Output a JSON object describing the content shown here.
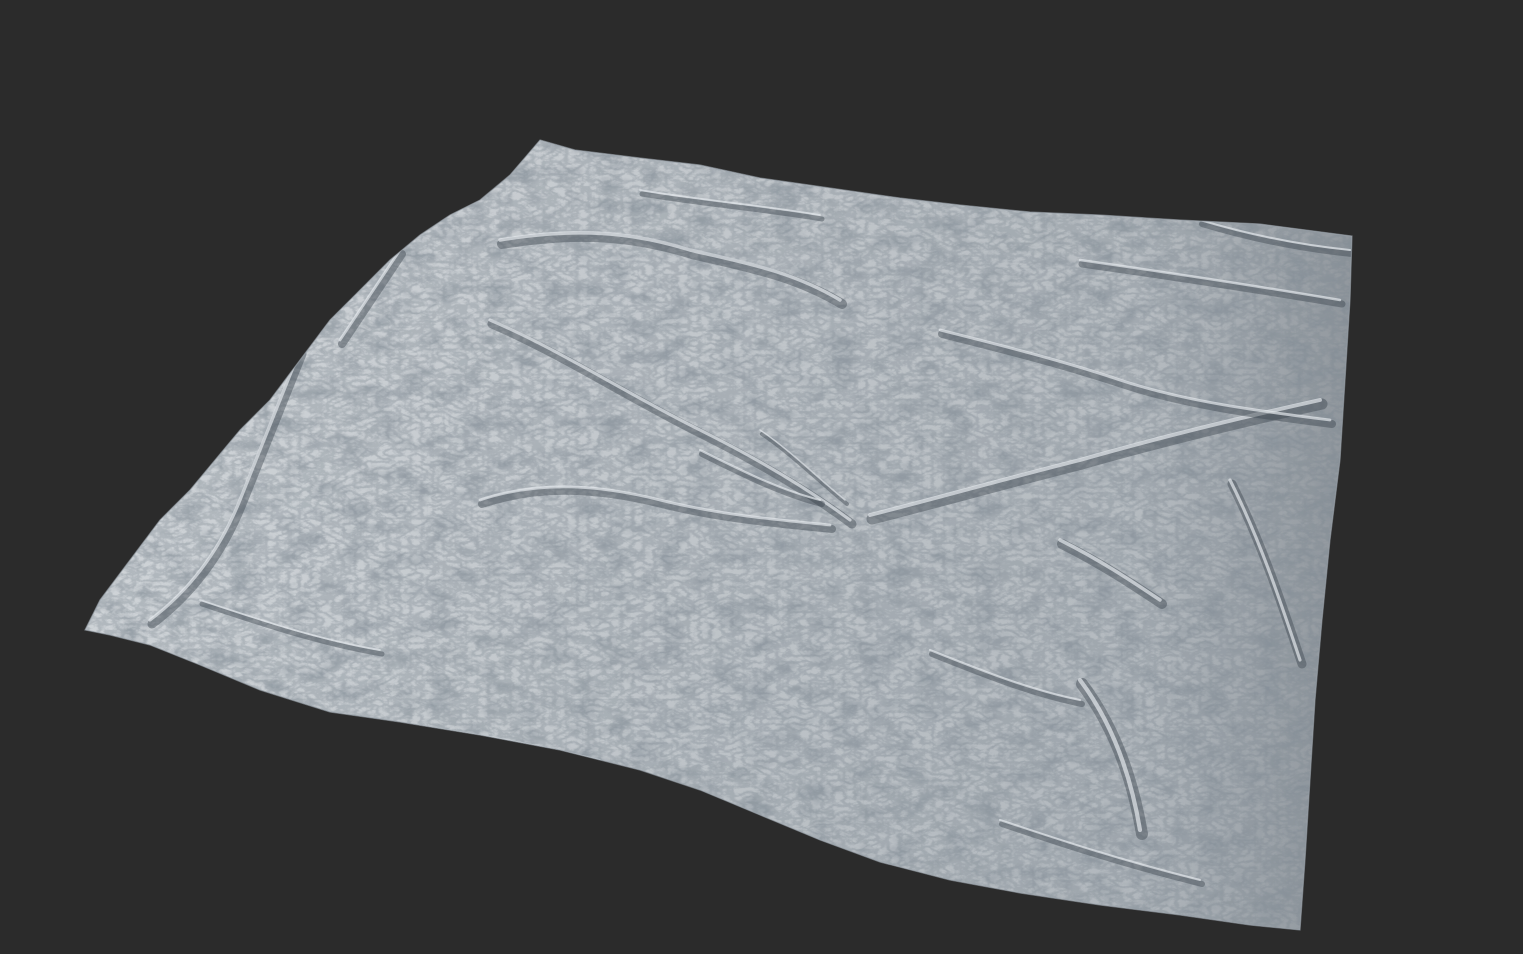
{
  "viewport": {
    "background_color": "#2b2b2b"
  },
  "terrain": {
    "subject": "3d-terrain-heightmap-render",
    "base_color": "#c9ced3",
    "highlight_color": "#e4e8ec",
    "shadow_color": "#3d4650",
    "deep_shadow_color": "#232a33"
  }
}
